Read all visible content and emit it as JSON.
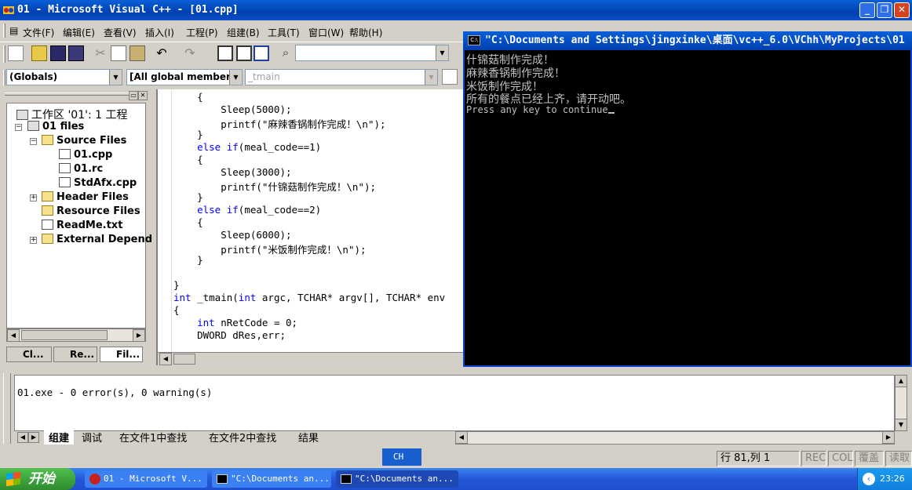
{
  "window": {
    "title": "01 - Microsoft Visual C++ - [01.cpp]"
  },
  "menu": [
    {
      "label": "文件(F)"
    },
    {
      "label": "编辑(E)"
    },
    {
      "label": "查看(V)"
    },
    {
      "label": "插入(I)"
    },
    {
      "label": "工程(P)"
    },
    {
      "label": "组建(B)"
    },
    {
      "label": "工具(T)"
    },
    {
      "label": "窗口(W)"
    },
    {
      "label": "帮助(H)"
    }
  ],
  "toolbar": {
    "globals_combo": "(Globals)",
    "members_combo": "[All global members",
    "function_combo": "_tmain",
    "find_combo": ""
  },
  "workspace": {
    "root": "工作区 '01': 1 工程",
    "project": "01 files",
    "source_folder": "Source Files",
    "source_files": [
      "01.cpp",
      "01.rc",
      "StdAfx.cpp"
    ],
    "header_folder": "Header Files",
    "resource_folder": "Resource Files",
    "readme": "ReadMe.txt",
    "external": "External Depend",
    "tabs": [
      "Cl...",
      "Re...",
      "Fil..."
    ]
  },
  "code": {
    "lines": [
      "    {",
      "        Sleep(5000);",
      "        printf(\"麻辣香锅制作完成！\\n\");",
      "    }",
      "    else if(meal_code==1)",
      "    {",
      "        Sleep(3000);",
      "        printf(\"什锦菇制作完成！\\n\");",
      "    }",
      "    else if(meal_code==2)",
      "    {",
      "        Sleep(6000);",
      "        printf(\"米饭制作完成！\\n\");",
      "    }",
      "",
      "}",
      "int _tmain(int argc, TCHAR* argv[], TCHAR* env",
      "{",
      "    int nRetCode = 0;",
      "    DWORD dRes,err;"
    ]
  },
  "console": {
    "title": "\"C:\\Documents and Settings\\jingxinke\\桌面\\vc++_6.0\\VChh\\MyProjects\\01",
    "lines": [
      "什锦菇制作完成！",
      "麻辣香锅制作完成！",
      "米饭制作完成！",
      "所有的餐点已经上齐，请开动吧。"
    ],
    "prompt": "Press any key to continue"
  },
  "output": {
    "text": "01.exe - 0 error(s), 0 warning(s)",
    "tabs": [
      "组建",
      "调试",
      "在文件1中查找",
      "在文件2中查找",
      "结果"
    ]
  },
  "status": {
    "ime": "CH",
    "position": "行 81,列 1",
    "rec": "REC",
    "col": "COL",
    "ovr": "覆盖",
    "read": "读取"
  },
  "taskbar": {
    "start": "开始",
    "tasks": [
      "01 - Microsoft V...",
      "\"C:\\Documents an...",
      "\"C:\\Documents an..."
    ],
    "clock": "23:26"
  }
}
